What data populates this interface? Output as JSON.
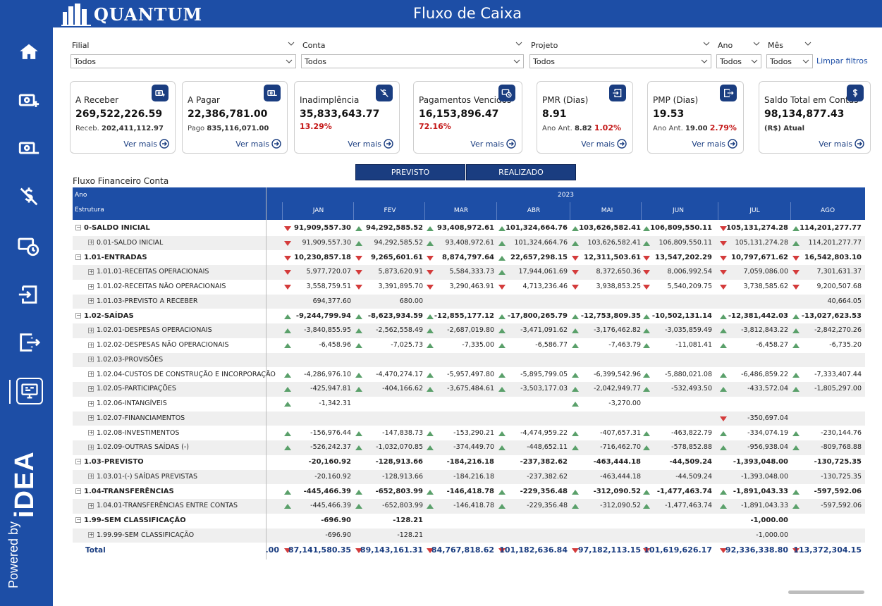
{
  "app": {
    "brand": "QUANTUM",
    "title": "Fluxo de Caixa"
  },
  "sidebar": {
    "items": [
      {
        "name": "home"
      },
      {
        "name": "receivable"
      },
      {
        "name": "payable"
      },
      {
        "name": "default"
      },
      {
        "name": "overdue"
      },
      {
        "name": "pmr"
      },
      {
        "name": "pmp"
      },
      {
        "name": "cashflow"
      }
    ],
    "powered_by": "Powered by",
    "vendor": "iDEA"
  },
  "filters": {
    "filial": {
      "label": "Filial",
      "value": "Todos"
    },
    "conta": {
      "label": "Conta",
      "value": "Todos"
    },
    "projeto": {
      "label": "Projeto",
      "value": "Todos"
    },
    "ano": {
      "label": "Ano",
      "value": "Todos"
    },
    "mes": {
      "label": "Mês",
      "value": "Todos"
    },
    "clear": "Limpar filtros"
  },
  "cards": [
    {
      "title": "A Receber",
      "value": "269,522,226.59",
      "sub_prefix": "Receb.",
      "sub_value": "202,411,112.97",
      "sub_red": "",
      "link": "Ver mais",
      "icon": "money-in-icon"
    },
    {
      "title": "A Pagar",
      "value": "22,386,781.00",
      "sub_prefix": "Pago",
      "sub_value": "835,116,071.00",
      "sub_red": "",
      "link": "Ver mais",
      "icon": "money-out-icon"
    },
    {
      "title": "Inadimplência",
      "value": "35,833,643.77",
      "sub_prefix": "",
      "sub_value": "",
      "sub_red": "13.29%",
      "link": "Ver mais",
      "icon": "no-money-icon"
    },
    {
      "title": "Pagamentos Vencidos",
      "value": "16,153,896.47",
      "sub_prefix": "",
      "sub_value": "",
      "sub_red": "72.16%",
      "link": "Ver mais",
      "icon": "overdue-icon"
    },
    {
      "title": "PMR (Dias)",
      "value": "8.91",
      "sub_prefix": "Ano Ant.",
      "sub_value": "8.82",
      "sub_red": "1.02%",
      "link": "Ver mais",
      "icon": "sign-in-icon"
    },
    {
      "title": "PMP (Dias)",
      "value": "19.53",
      "sub_prefix": "Ano Ant.",
      "sub_value": "19.00",
      "sub_red": "2.79%",
      "link": "Ver mais",
      "icon": "sign-out-icon"
    },
    {
      "title": "Saldo Total em Contas",
      "value": "98,134,877.43",
      "sub_prefix": "",
      "sub_value": "(R$) Atual",
      "sub_red": "",
      "link": "Ver mais",
      "icon": "dollar-icon"
    }
  ],
  "toggle": {
    "previsto": "PREVISTO",
    "realizado": "REALIZADO"
  },
  "table": {
    "title": "Fluxo Financeiro Conta",
    "header_ano": "Ano",
    "header_estrutura": "Estrutura",
    "year": "2023",
    "months": [
      "JAN",
      "FEV",
      "MAR",
      "ABR",
      "MAI",
      "JUN",
      "JUL",
      "AGO"
    ],
    "rows": [
      {
        "label": "0-SALDO INICIAL",
        "level": 0,
        "bold": true,
        "cells": [
          [
            "down",
            "91,909,557.30"
          ],
          [
            "up",
            "94,292,585.52"
          ],
          [
            "up",
            "93,408,972.61"
          ],
          [
            "up",
            "101,324,664.76"
          ],
          [
            "up",
            "103,626,582.41"
          ],
          [
            "up",
            "106,809,550.11"
          ],
          [
            "down",
            "105,131,274.28"
          ],
          [
            "up",
            "114,201,277.77"
          ]
        ]
      },
      {
        "label": "0.01-SALDO INICIAL",
        "level": 1,
        "bold": false,
        "cells": [
          [
            "down",
            "91,909,557.30"
          ],
          [
            "up",
            "94,292,585.52"
          ],
          [
            "up",
            "93,408,972.61"
          ],
          [
            "up",
            "101,324,664.76"
          ],
          [
            "up",
            "103,626,582.41"
          ],
          [
            "up",
            "106,809,550.11"
          ],
          [
            "down",
            "105,131,274.28"
          ],
          [
            "up",
            "114,201,277.77"
          ]
        ]
      },
      {
        "label": "1.01-ENTRADAS",
        "level": 0,
        "bold": true,
        "cells": [
          [
            "down",
            "10,230,857.18"
          ],
          [
            "down",
            "9,265,601.61"
          ],
          [
            "down",
            "8,874,797.64"
          ],
          [
            "up",
            "22,657,298.15"
          ],
          [
            "down",
            "12,311,503.61"
          ],
          [
            "down",
            "13,547,202.29"
          ],
          [
            "down",
            "10,797,671.62"
          ],
          [
            "down",
            "16,542,803.10"
          ]
        ]
      },
      {
        "label": "1.01.01-RECEITAS OPERACIONAIS",
        "level": 1,
        "bold": false,
        "cells": [
          [
            "down",
            "5,977,720.07"
          ],
          [
            "down",
            "5,873,620.91"
          ],
          [
            "down",
            "5,584,333.73"
          ],
          [
            "up",
            "17,944,061.69"
          ],
          [
            "down",
            "8,372,650.36"
          ],
          [
            "down",
            "8,006,992.54"
          ],
          [
            "down",
            "7,059,086.00"
          ],
          [
            "down",
            "7,301,631.37"
          ]
        ]
      },
      {
        "label": "1.01.02-RECEITAS NÃO OPERACIONAIS",
        "level": 1,
        "bold": false,
        "cells": [
          [
            "down",
            "3,558,759.51"
          ],
          [
            "down",
            "3,391,895.70"
          ],
          [
            "down",
            "3,290,463.91"
          ],
          [
            "down",
            "4,713,236.46"
          ],
          [
            "down",
            "3,938,853.25"
          ],
          [
            "down",
            "5,540,209.75"
          ],
          [
            "down",
            "3,738,585.62"
          ],
          [
            "down",
            "9,200,507.68"
          ]
        ]
      },
      {
        "label": "1.01.03-PREVISTO A RECEBER",
        "level": 1,
        "bold": false,
        "cells": [
          [
            "",
            "694,377.60"
          ],
          [
            "",
            "680.00"
          ],
          [
            "",
            ""
          ],
          [
            "",
            ""
          ],
          [
            "",
            ""
          ],
          [
            "",
            ""
          ],
          [
            "",
            ""
          ],
          [
            "",
            "40,664.05"
          ]
        ]
      },
      {
        "label": "1.02-SAÍDAS",
        "level": 0,
        "bold": true,
        "cells": [
          [
            "up",
            "-9,244,799.94"
          ],
          [
            "up",
            "-8,623,934.59"
          ],
          [
            "up",
            "-12,855,177.12"
          ],
          [
            "up",
            "-17,800,265.79"
          ],
          [
            "up",
            "-12,753,809.35"
          ],
          [
            "up",
            "-10,502,131.14"
          ],
          [
            "up",
            "-12,381,442.03"
          ],
          [
            "up",
            "-13,027,623.53"
          ]
        ]
      },
      {
        "label": "1.02.01-DESPESAS OPERACIONAIS",
        "level": 1,
        "bold": false,
        "cells": [
          [
            "up",
            "-3,840,855.95"
          ],
          [
            "up",
            "-2,562,558.49"
          ],
          [
            "up",
            "-2,687,019.80"
          ],
          [
            "up",
            "-3,471,091.62"
          ],
          [
            "up",
            "-3,176,462.82"
          ],
          [
            "up",
            "-3,035,859.49"
          ],
          [
            "up",
            "-3,812,843.22"
          ],
          [
            "up",
            "-2,842,270.26"
          ]
        ]
      },
      {
        "label": "1.02.02-DESPESAS NÃO OPERACIONAIS",
        "level": 1,
        "bold": false,
        "cells": [
          [
            "up",
            "-6,458.96"
          ],
          [
            "up",
            "-7,025.73"
          ],
          [
            "up",
            "-7,335.00"
          ],
          [
            "up",
            "-6,586.77"
          ],
          [
            "up",
            "-7,463.79"
          ],
          [
            "up",
            "-11,081.41"
          ],
          [
            "up",
            "-6,458.27"
          ],
          [
            "up",
            "-6,735.20"
          ]
        ]
      },
      {
        "label": "1.02.03-PROVISÕES",
        "level": 1,
        "bold": false,
        "cells": [
          [
            "",
            ""
          ],
          [
            "",
            ""
          ],
          [
            "",
            ""
          ],
          [
            "",
            ""
          ],
          [
            "",
            ""
          ],
          [
            "",
            ""
          ],
          [
            "",
            ""
          ],
          [
            "",
            ""
          ]
        ]
      },
      {
        "label": "1.02.04-CUSTOS DE CONSTRUÇÃO E INCORPORAÇÃO",
        "level": 1,
        "bold": false,
        "cells": [
          [
            "up",
            "-4,286,976.10"
          ],
          [
            "up",
            "-4,470,274.17"
          ],
          [
            "up",
            "-5,957,497.80"
          ],
          [
            "up",
            "-5,895,799.05"
          ],
          [
            "up",
            "-6,399,542.96"
          ],
          [
            "up",
            "-5,880,021.08"
          ],
          [
            "up",
            "-6,486,859.22"
          ],
          [
            "up",
            "-7,333,407.44"
          ]
        ]
      },
      {
        "label": "1.02.05-PARTICIPAÇÕES",
        "level": 1,
        "bold": false,
        "cells": [
          [
            "up",
            "-425,947.81"
          ],
          [
            "up",
            "-404,166.62"
          ],
          [
            "up",
            "-3,675,484.61"
          ],
          [
            "up",
            "-3,503,177.03"
          ],
          [
            "up",
            "-2,042,949.77"
          ],
          [
            "up",
            "-532,493.50"
          ],
          [
            "up",
            "-433,572.04"
          ],
          [
            "up",
            "-1,805,297.00"
          ]
        ]
      },
      {
        "label": "1.02.06-INTANGÍVEIS",
        "level": 1,
        "bold": false,
        "cells": [
          [
            "up",
            "-1,342.31"
          ],
          [
            "",
            ""
          ],
          [
            "",
            ""
          ],
          [
            "",
            ""
          ],
          [
            "up",
            "-3,270.00"
          ],
          [
            "",
            ""
          ],
          [
            "",
            ""
          ],
          [
            "",
            ""
          ]
        ]
      },
      {
        "label": "1.02.07-FINANCIAMENTOS",
        "level": 1,
        "bold": false,
        "cells": [
          [
            "",
            ""
          ],
          [
            "",
            ""
          ],
          [
            "",
            ""
          ],
          [
            "",
            ""
          ],
          [
            "",
            ""
          ],
          [
            "",
            ""
          ],
          [
            "down",
            "-350,697.04"
          ],
          [
            "",
            ""
          ]
        ]
      },
      {
        "label": "1.02.08-INVESTIMENTOS",
        "level": 1,
        "bold": false,
        "cells": [
          [
            "up",
            "-156,976.44"
          ],
          [
            "up",
            "-147,838.73"
          ],
          [
            "up",
            "-153,290.21"
          ],
          [
            "up",
            "-4,474,959.22"
          ],
          [
            "up",
            "-407,657.31"
          ],
          [
            "up",
            "-463,822.79"
          ],
          [
            "up",
            "-334,074.19"
          ],
          [
            "up",
            "-230,144.76"
          ]
        ]
      },
      {
        "label": "1.02.09-OUTRAS SAÍDAS (-)",
        "level": 1,
        "bold": false,
        "cells": [
          [
            "up",
            "-526,242.37"
          ],
          [
            "up",
            "-1,032,070.85"
          ],
          [
            "up",
            "-374,449.70"
          ],
          [
            "up",
            "-448,652.11"
          ],
          [
            "up",
            "-716,462.70"
          ],
          [
            "up",
            "-578,852.88"
          ],
          [
            "up",
            "-956,938.04"
          ],
          [
            "up",
            "-809,768.88"
          ]
        ]
      },
      {
        "label": "1.03-PREVISTO",
        "level": 0,
        "bold": true,
        "cells": [
          [
            "",
            "-20,160.92"
          ],
          [
            "",
            "-128,913.66"
          ],
          [
            "",
            "-184,216.18"
          ],
          [
            "",
            "-237,382.62"
          ],
          [
            "",
            "-463,444.18"
          ],
          [
            "",
            "-44,509.24"
          ],
          [
            "",
            "-1,393,048.00"
          ],
          [
            "",
            "-130,725.35"
          ]
        ]
      },
      {
        "label": "1.03.01-(-) SAÍDAS PREVISTAS",
        "level": 1,
        "bold": false,
        "cells": [
          [
            "",
            "-20,160.92"
          ],
          [
            "",
            "-128,913.66"
          ],
          [
            "",
            "-184,216.18"
          ],
          [
            "",
            "-237,382.62"
          ],
          [
            "",
            "-463,444.18"
          ],
          [
            "",
            "-44,509.24"
          ],
          [
            "",
            "-1,393,048.00"
          ],
          [
            "",
            "-130,725.35"
          ]
        ]
      },
      {
        "label": "1.04-TRANSFERÊNCIAS",
        "level": 0,
        "bold": true,
        "cells": [
          [
            "up",
            "-445,466.39"
          ],
          [
            "up",
            "-652,803.99"
          ],
          [
            "up",
            "-146,418.78"
          ],
          [
            "up",
            "-229,356.48"
          ],
          [
            "up",
            "-312,090.52"
          ],
          [
            "up",
            "-1,477,463.74"
          ],
          [
            "up",
            "-1,891,043.33"
          ],
          [
            "up",
            "-597,592.06"
          ]
        ]
      },
      {
        "label": "1.04.01-TRANSFERÊNCIAS ENTRE CONTAS",
        "level": 1,
        "bold": false,
        "cells": [
          [
            "up",
            "-445,466.39"
          ],
          [
            "up",
            "-652,803.99"
          ],
          [
            "up",
            "-146,418.78"
          ],
          [
            "up",
            "-229,356.48"
          ],
          [
            "up",
            "-312,090.52"
          ],
          [
            "up",
            "-1,477,463.74"
          ],
          [
            "up",
            "-1,891,043.33"
          ],
          [
            "up",
            "-597,592.06"
          ]
        ]
      },
      {
        "label": "1.99-SEM CLASSIFICAÇÃO",
        "level": 0,
        "bold": true,
        "cells": [
          [
            "",
            "-696.90"
          ],
          [
            "",
            "-128.21"
          ],
          [
            "",
            ""
          ],
          [
            "",
            ""
          ],
          [
            "",
            ""
          ],
          [
            "",
            ""
          ],
          [
            "",
            "-1,000.00"
          ],
          [
            "",
            ""
          ]
        ]
      },
      {
        "label": "1.99.99-SEM CLASSIFICAÇÃO",
        "level": 1,
        "bold": false,
        "cells": [
          [
            "",
            "-696.90"
          ],
          [
            "",
            "-128.21"
          ],
          [
            "",
            ""
          ],
          [
            "",
            ""
          ],
          [
            "",
            ""
          ],
          [
            "",
            ""
          ],
          [
            "",
            "-1,000.00"
          ],
          [
            "",
            ""
          ]
        ]
      }
    ],
    "total": {
      "label": "Total",
      "frozen": ".00",
      "cells": [
        [
          "down",
          "87,141,580.35"
        ],
        [
          "down",
          "89,143,161.31"
        ],
        [
          "down",
          "84,767,818.62"
        ],
        [
          "down",
          "101,182,636.84"
        ],
        [
          "down",
          "97,182,113.15"
        ],
        [
          "down",
          "101,619,626.17"
        ],
        [
          "down",
          "92,336,338.80"
        ],
        [
          "down",
          "113,372,304.15"
        ]
      ]
    }
  }
}
